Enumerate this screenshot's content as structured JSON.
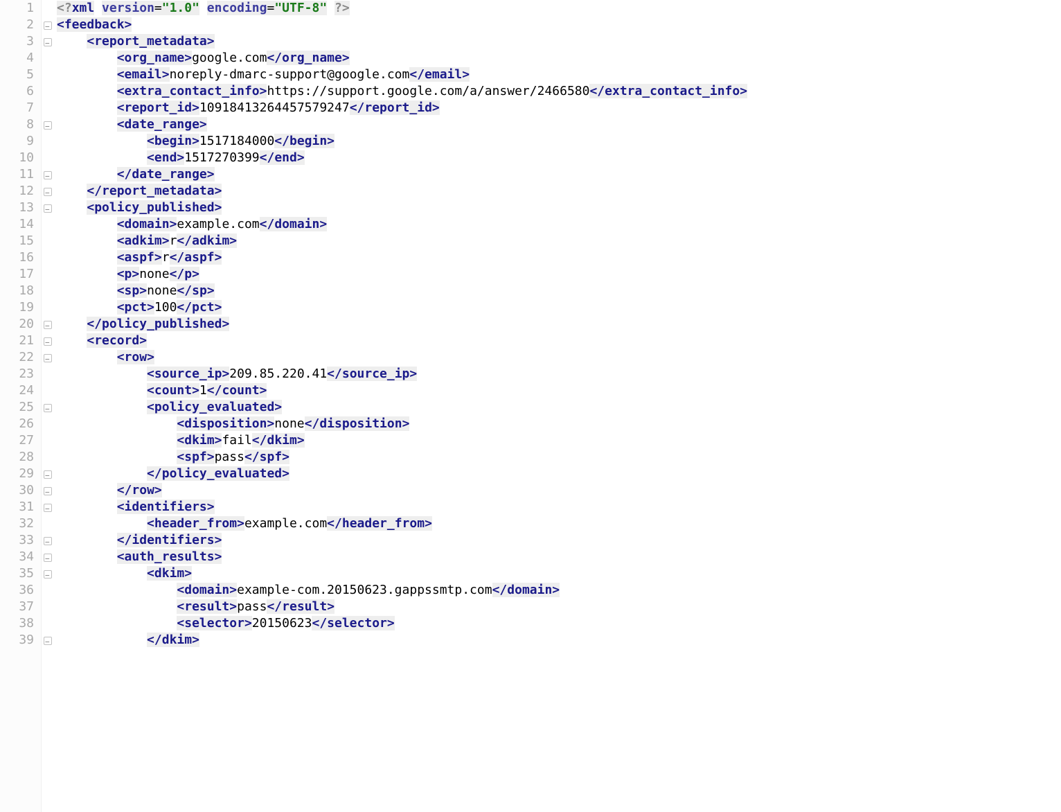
{
  "lines": [
    {
      "n": 1,
      "indent": 0,
      "fold": null,
      "tokens": [
        {
          "t": "<?",
          "cls": "pi"
        },
        {
          "t": "xml",
          "cls": "decl tagbg"
        },
        {
          "t": " ",
          "cls": ""
        },
        {
          "t": "version",
          "cls": "attr-name tagbg"
        },
        {
          "t": "=",
          "cls": "txt tagbg"
        },
        {
          "t": "\"1.0\"",
          "cls": "attr-val tagbg"
        },
        {
          "t": " ",
          "cls": ""
        },
        {
          "t": "encoding",
          "cls": "attr-name tagbg"
        },
        {
          "t": "=",
          "cls": "txt tagbg"
        },
        {
          "t": "\"UTF-8\"",
          "cls": "attr-val tagbg"
        },
        {
          "t": " ",
          "cls": ""
        },
        {
          "t": "?>",
          "cls": "pi"
        }
      ]
    },
    {
      "n": 2,
      "indent": 0,
      "fold": "open",
      "tokens": [
        {
          "t": "<",
          "cls": "ab"
        },
        {
          "t": "feedback",
          "cls": "tag-name tagbg"
        },
        {
          "t": ">",
          "cls": "ab"
        }
      ]
    },
    {
      "n": 3,
      "indent": 1,
      "fold": "open",
      "tokens": [
        {
          "t": "<",
          "cls": "ab"
        },
        {
          "t": "report_metadata",
          "cls": "tag-name tagbg"
        },
        {
          "t": ">",
          "cls": "ab"
        }
      ]
    },
    {
      "n": 4,
      "indent": 2,
      "fold": null,
      "tokens": [
        {
          "t": "<",
          "cls": "ab"
        },
        {
          "t": "org_name",
          "cls": "tag-name tagbg"
        },
        {
          "t": ">",
          "cls": "ab"
        },
        {
          "t": "google.com",
          "cls": "txt"
        },
        {
          "t": "</",
          "cls": "ab"
        },
        {
          "t": "org_name",
          "cls": "tag-name tagbg"
        },
        {
          "t": ">",
          "cls": "ab"
        }
      ]
    },
    {
      "n": 5,
      "indent": 2,
      "fold": null,
      "tokens": [
        {
          "t": "<",
          "cls": "ab"
        },
        {
          "t": "email",
          "cls": "tag-name tagbg"
        },
        {
          "t": ">",
          "cls": "ab"
        },
        {
          "t": "noreply-dmarc-support@google.com",
          "cls": "txt"
        },
        {
          "t": "</",
          "cls": "ab"
        },
        {
          "t": "email",
          "cls": "tag-name tagbg"
        },
        {
          "t": ">",
          "cls": "ab"
        }
      ]
    },
    {
      "n": 6,
      "indent": 2,
      "fold": null,
      "tokens": [
        {
          "t": "<",
          "cls": "ab"
        },
        {
          "t": "extra_contact_info",
          "cls": "tag-name tagbg"
        },
        {
          "t": ">",
          "cls": "ab"
        },
        {
          "t": "https://support.google.com/a/answer/2466580",
          "cls": "txt"
        },
        {
          "t": "</",
          "cls": "ab"
        },
        {
          "t": "extra_contact_info",
          "cls": "tag-name tagbg"
        },
        {
          "t": ">",
          "cls": "ab"
        }
      ]
    },
    {
      "n": 7,
      "indent": 2,
      "fold": null,
      "tokens": [
        {
          "t": "<",
          "cls": "ab"
        },
        {
          "t": "report_id",
          "cls": "tag-name tagbg"
        },
        {
          "t": ">",
          "cls": "ab"
        },
        {
          "t": "10918413264457579247",
          "cls": "txt"
        },
        {
          "t": "</",
          "cls": "ab"
        },
        {
          "t": "report_id",
          "cls": "tag-name tagbg"
        },
        {
          "t": ">",
          "cls": "ab"
        }
      ]
    },
    {
      "n": 8,
      "indent": 2,
      "fold": "open",
      "tokens": [
        {
          "t": "<",
          "cls": "ab"
        },
        {
          "t": "date_range",
          "cls": "tag-name tagbg"
        },
        {
          "t": ">",
          "cls": "ab"
        }
      ]
    },
    {
      "n": 9,
      "indent": 3,
      "fold": null,
      "tokens": [
        {
          "t": "<",
          "cls": "ab"
        },
        {
          "t": "begin",
          "cls": "tag-name tagbg"
        },
        {
          "t": ">",
          "cls": "ab"
        },
        {
          "t": "1517184000",
          "cls": "txt"
        },
        {
          "t": "</",
          "cls": "ab"
        },
        {
          "t": "begin",
          "cls": "tag-name tagbg"
        },
        {
          "t": ">",
          "cls": "ab"
        }
      ]
    },
    {
      "n": 10,
      "indent": 3,
      "fold": null,
      "tokens": [
        {
          "t": "<",
          "cls": "ab"
        },
        {
          "t": "end",
          "cls": "tag-name tagbg"
        },
        {
          "t": ">",
          "cls": "ab"
        },
        {
          "t": "1517270399",
          "cls": "txt"
        },
        {
          "t": "</",
          "cls": "ab"
        },
        {
          "t": "end",
          "cls": "tag-name tagbg"
        },
        {
          "t": ">",
          "cls": "ab"
        }
      ]
    },
    {
      "n": 11,
      "indent": 2,
      "fold": "close",
      "tokens": [
        {
          "t": "</",
          "cls": "ab"
        },
        {
          "t": "date_range",
          "cls": "tag-name tagbg"
        },
        {
          "t": ">",
          "cls": "ab"
        }
      ]
    },
    {
      "n": 12,
      "indent": 1,
      "fold": "close",
      "tokens": [
        {
          "t": "</",
          "cls": "ab"
        },
        {
          "t": "report_metadata",
          "cls": "tag-name tagbg"
        },
        {
          "t": ">",
          "cls": "ab"
        }
      ]
    },
    {
      "n": 13,
      "indent": 1,
      "fold": "open",
      "tokens": [
        {
          "t": "<",
          "cls": "ab"
        },
        {
          "t": "policy_published",
          "cls": "tag-name tagbg"
        },
        {
          "t": ">",
          "cls": "ab"
        }
      ]
    },
    {
      "n": 14,
      "indent": 2,
      "fold": null,
      "tokens": [
        {
          "t": "<",
          "cls": "ab"
        },
        {
          "t": "domain",
          "cls": "tag-name tagbg"
        },
        {
          "t": ">",
          "cls": "ab"
        },
        {
          "t": "example.com",
          "cls": "txt"
        },
        {
          "t": "</",
          "cls": "ab"
        },
        {
          "t": "domain",
          "cls": "tag-name tagbg"
        },
        {
          "t": ">",
          "cls": "ab"
        }
      ]
    },
    {
      "n": 15,
      "indent": 2,
      "fold": null,
      "tokens": [
        {
          "t": "<",
          "cls": "ab"
        },
        {
          "t": "adkim",
          "cls": "tag-name tagbg"
        },
        {
          "t": ">",
          "cls": "ab"
        },
        {
          "t": "r",
          "cls": "txt"
        },
        {
          "t": "</",
          "cls": "ab"
        },
        {
          "t": "adkim",
          "cls": "tag-name tagbg"
        },
        {
          "t": ">",
          "cls": "ab"
        }
      ]
    },
    {
      "n": 16,
      "indent": 2,
      "fold": null,
      "tokens": [
        {
          "t": "<",
          "cls": "ab"
        },
        {
          "t": "aspf",
          "cls": "tag-name tagbg"
        },
        {
          "t": ">",
          "cls": "ab"
        },
        {
          "t": "r",
          "cls": "txt"
        },
        {
          "t": "</",
          "cls": "ab"
        },
        {
          "t": "aspf",
          "cls": "tag-name tagbg"
        },
        {
          "t": ">",
          "cls": "ab"
        }
      ]
    },
    {
      "n": 17,
      "indent": 2,
      "fold": null,
      "tokens": [
        {
          "t": "<",
          "cls": "ab"
        },
        {
          "t": "p",
          "cls": "tag-name tagbg"
        },
        {
          "t": ">",
          "cls": "ab"
        },
        {
          "t": "none",
          "cls": "txt"
        },
        {
          "t": "</",
          "cls": "ab"
        },
        {
          "t": "p",
          "cls": "tag-name tagbg"
        },
        {
          "t": ">",
          "cls": "ab"
        }
      ]
    },
    {
      "n": 18,
      "indent": 2,
      "fold": null,
      "tokens": [
        {
          "t": "<",
          "cls": "ab"
        },
        {
          "t": "sp",
          "cls": "tag-name tagbg"
        },
        {
          "t": ">",
          "cls": "ab"
        },
        {
          "t": "none",
          "cls": "txt"
        },
        {
          "t": "</",
          "cls": "ab"
        },
        {
          "t": "sp",
          "cls": "tag-name tagbg"
        },
        {
          "t": ">",
          "cls": "ab"
        }
      ]
    },
    {
      "n": 19,
      "indent": 2,
      "fold": null,
      "tokens": [
        {
          "t": "<",
          "cls": "ab"
        },
        {
          "t": "pct",
          "cls": "tag-name tagbg"
        },
        {
          "t": ">",
          "cls": "ab"
        },
        {
          "t": "100",
          "cls": "txt"
        },
        {
          "t": "</",
          "cls": "ab"
        },
        {
          "t": "pct",
          "cls": "tag-name tagbg"
        },
        {
          "t": ">",
          "cls": "ab"
        }
      ]
    },
    {
      "n": 20,
      "indent": 1,
      "fold": "close",
      "tokens": [
        {
          "t": "</",
          "cls": "ab"
        },
        {
          "t": "policy_published",
          "cls": "tag-name tagbg"
        },
        {
          "t": ">",
          "cls": "ab"
        }
      ]
    },
    {
      "n": 21,
      "indent": 1,
      "fold": "open",
      "tokens": [
        {
          "t": "<",
          "cls": "ab"
        },
        {
          "t": "record",
          "cls": "tag-name tagbg"
        },
        {
          "t": ">",
          "cls": "ab"
        }
      ]
    },
    {
      "n": 22,
      "indent": 2,
      "fold": "open",
      "tokens": [
        {
          "t": "<",
          "cls": "ab"
        },
        {
          "t": "row",
          "cls": "tag-name tagbg"
        },
        {
          "t": ">",
          "cls": "ab"
        }
      ]
    },
    {
      "n": 23,
      "indent": 3,
      "fold": null,
      "tokens": [
        {
          "t": "<",
          "cls": "ab"
        },
        {
          "t": "source_ip",
          "cls": "tag-name tagbg"
        },
        {
          "t": ">",
          "cls": "ab"
        },
        {
          "t": "209.85.220.41",
          "cls": "txt"
        },
        {
          "t": "</",
          "cls": "ab"
        },
        {
          "t": "source_ip",
          "cls": "tag-name tagbg"
        },
        {
          "t": ">",
          "cls": "ab"
        }
      ]
    },
    {
      "n": 24,
      "indent": 3,
      "fold": null,
      "tokens": [
        {
          "t": "<",
          "cls": "ab"
        },
        {
          "t": "count",
          "cls": "tag-name tagbg"
        },
        {
          "t": ">",
          "cls": "ab"
        },
        {
          "t": "1",
          "cls": "txt"
        },
        {
          "t": "</",
          "cls": "ab"
        },
        {
          "t": "count",
          "cls": "tag-name tagbg"
        },
        {
          "t": ">",
          "cls": "ab"
        }
      ]
    },
    {
      "n": 25,
      "indent": 3,
      "fold": "open",
      "tokens": [
        {
          "t": "<",
          "cls": "ab"
        },
        {
          "t": "policy_evaluated",
          "cls": "tag-name tagbg"
        },
        {
          "t": ">",
          "cls": "ab"
        }
      ]
    },
    {
      "n": 26,
      "indent": 4,
      "fold": null,
      "tokens": [
        {
          "t": "<",
          "cls": "ab"
        },
        {
          "t": "disposition",
          "cls": "tag-name tagbg"
        },
        {
          "t": ">",
          "cls": "ab"
        },
        {
          "t": "none",
          "cls": "txt"
        },
        {
          "t": "</",
          "cls": "ab"
        },
        {
          "t": "disposition",
          "cls": "tag-name tagbg"
        },
        {
          "t": ">",
          "cls": "ab"
        }
      ]
    },
    {
      "n": 27,
      "indent": 4,
      "fold": null,
      "tokens": [
        {
          "t": "<",
          "cls": "ab"
        },
        {
          "t": "dkim",
          "cls": "tag-name tagbg"
        },
        {
          "t": ">",
          "cls": "ab"
        },
        {
          "t": "fail",
          "cls": "txt"
        },
        {
          "t": "</",
          "cls": "ab"
        },
        {
          "t": "dkim",
          "cls": "tag-name tagbg"
        },
        {
          "t": ">",
          "cls": "ab"
        }
      ]
    },
    {
      "n": 28,
      "indent": 4,
      "fold": null,
      "tokens": [
        {
          "t": "<",
          "cls": "ab"
        },
        {
          "t": "spf",
          "cls": "tag-name tagbg"
        },
        {
          "t": ">",
          "cls": "ab"
        },
        {
          "t": "pass",
          "cls": "txt"
        },
        {
          "t": "</",
          "cls": "ab"
        },
        {
          "t": "spf",
          "cls": "tag-name tagbg"
        },
        {
          "t": ">",
          "cls": "ab"
        }
      ]
    },
    {
      "n": 29,
      "indent": 3,
      "fold": "close",
      "tokens": [
        {
          "t": "</",
          "cls": "ab"
        },
        {
          "t": "policy_evaluated",
          "cls": "tag-name tagbg"
        },
        {
          "t": ">",
          "cls": "ab"
        }
      ]
    },
    {
      "n": 30,
      "indent": 2,
      "fold": "close",
      "tokens": [
        {
          "t": "</",
          "cls": "ab"
        },
        {
          "t": "row",
          "cls": "tag-name tagbg"
        },
        {
          "t": ">",
          "cls": "ab"
        }
      ]
    },
    {
      "n": 31,
      "indent": 2,
      "fold": "open",
      "tokens": [
        {
          "t": "<",
          "cls": "ab"
        },
        {
          "t": "identifiers",
          "cls": "tag-name tagbg"
        },
        {
          "t": ">",
          "cls": "ab"
        }
      ]
    },
    {
      "n": 32,
      "indent": 3,
      "fold": null,
      "tokens": [
        {
          "t": "<",
          "cls": "ab"
        },
        {
          "t": "header_from",
          "cls": "tag-name tagbg"
        },
        {
          "t": ">",
          "cls": "ab"
        },
        {
          "t": "example.com",
          "cls": "txt"
        },
        {
          "t": "</",
          "cls": "ab"
        },
        {
          "t": "header_from",
          "cls": "tag-name tagbg"
        },
        {
          "t": ">",
          "cls": "ab"
        }
      ]
    },
    {
      "n": 33,
      "indent": 2,
      "fold": "close",
      "tokens": [
        {
          "t": "</",
          "cls": "ab"
        },
        {
          "t": "identifiers",
          "cls": "tag-name tagbg"
        },
        {
          "t": ">",
          "cls": "ab"
        }
      ]
    },
    {
      "n": 34,
      "indent": 2,
      "fold": "open",
      "tokens": [
        {
          "t": "<",
          "cls": "ab"
        },
        {
          "t": "auth_results",
          "cls": "tag-name tagbg"
        },
        {
          "t": ">",
          "cls": "ab"
        }
      ]
    },
    {
      "n": 35,
      "indent": 3,
      "fold": "open",
      "tokens": [
        {
          "t": "<",
          "cls": "ab"
        },
        {
          "t": "dkim",
          "cls": "tag-name tagbg"
        },
        {
          "t": ">",
          "cls": "ab"
        }
      ]
    },
    {
      "n": 36,
      "indent": 4,
      "fold": null,
      "tokens": [
        {
          "t": "<",
          "cls": "ab"
        },
        {
          "t": "domain",
          "cls": "tag-name tagbg"
        },
        {
          "t": ">",
          "cls": "ab"
        },
        {
          "t": "example-com.20150623.gappssmtp.com",
          "cls": "txt"
        },
        {
          "t": "</",
          "cls": "ab"
        },
        {
          "t": "domain",
          "cls": "tag-name tagbg"
        },
        {
          "t": ">",
          "cls": "ab"
        }
      ]
    },
    {
      "n": 37,
      "indent": 4,
      "fold": null,
      "tokens": [
        {
          "t": "<",
          "cls": "ab"
        },
        {
          "t": "result",
          "cls": "tag-name tagbg"
        },
        {
          "t": ">",
          "cls": "ab"
        },
        {
          "t": "pass",
          "cls": "txt"
        },
        {
          "t": "</",
          "cls": "ab"
        },
        {
          "t": "result",
          "cls": "tag-name tagbg"
        },
        {
          "t": ">",
          "cls": "ab"
        }
      ]
    },
    {
      "n": 38,
      "indent": 4,
      "fold": null,
      "tokens": [
        {
          "t": "<",
          "cls": "ab"
        },
        {
          "t": "selector",
          "cls": "tag-name tagbg"
        },
        {
          "t": ">",
          "cls": "ab"
        },
        {
          "t": "20150623",
          "cls": "txt"
        },
        {
          "t": "</",
          "cls": "ab"
        },
        {
          "t": "selector",
          "cls": "tag-name tagbg"
        },
        {
          "t": ">",
          "cls": "ab"
        }
      ]
    },
    {
      "n": 39,
      "indent": 3,
      "fold": "close",
      "tokens": [
        {
          "t": "</",
          "cls": "ab"
        },
        {
          "t": "dkim",
          "cls": "tag-name tagbg"
        },
        {
          "t": ">",
          "cls": "ab"
        }
      ]
    }
  ]
}
